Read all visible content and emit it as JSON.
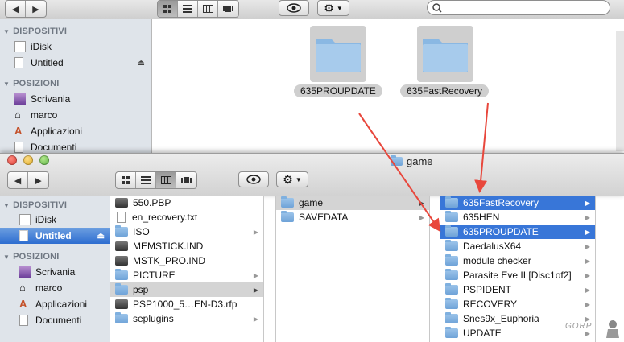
{
  "back_window": {
    "sidebar": {
      "devices_header": "DISPOSITIVI",
      "devices": [
        "iDisk",
        "Untitled"
      ],
      "places_header": "POSIZIONI",
      "places": [
        "Scrivania",
        "marco",
        "Applicazioni",
        "Documenti"
      ]
    },
    "folders": [
      "635PROUPDATE",
      "635FastRecovery"
    ]
  },
  "front_window": {
    "title": "game",
    "sidebar": {
      "devices_header": "DISPOSITIVI",
      "devices": [
        "iDisk",
        "Untitled"
      ],
      "places_header": "POSIZIONI",
      "places": [
        "Scrivania",
        "marco",
        "Applicazioni",
        "Documenti"
      ]
    },
    "column1": [
      "550.PBP",
      "en_recovery.txt",
      "ISO",
      "MEMSTICK.IND",
      "MSTK_PRO.IND",
      "PICTURE",
      "psp",
      "PSP1000_5…EN-D3.rfp",
      "seplugins"
    ],
    "column2": [
      "game",
      "SAVEDATA"
    ],
    "column3": [
      "635FastRecovery",
      "635HEN",
      "635PROUPDATE",
      "DaedalusX64",
      "module checker",
      "Parasite Eve II [Disc1of2]",
      "PSPIDENT",
      "RECOVERY",
      "Snes9x_Euphoria",
      "UPDATE"
    ]
  },
  "watermark": "GORP",
  "colors": {
    "selection": "#3876d8",
    "arrow": "#e8473c",
    "sidebar": "#dfe4ea"
  }
}
